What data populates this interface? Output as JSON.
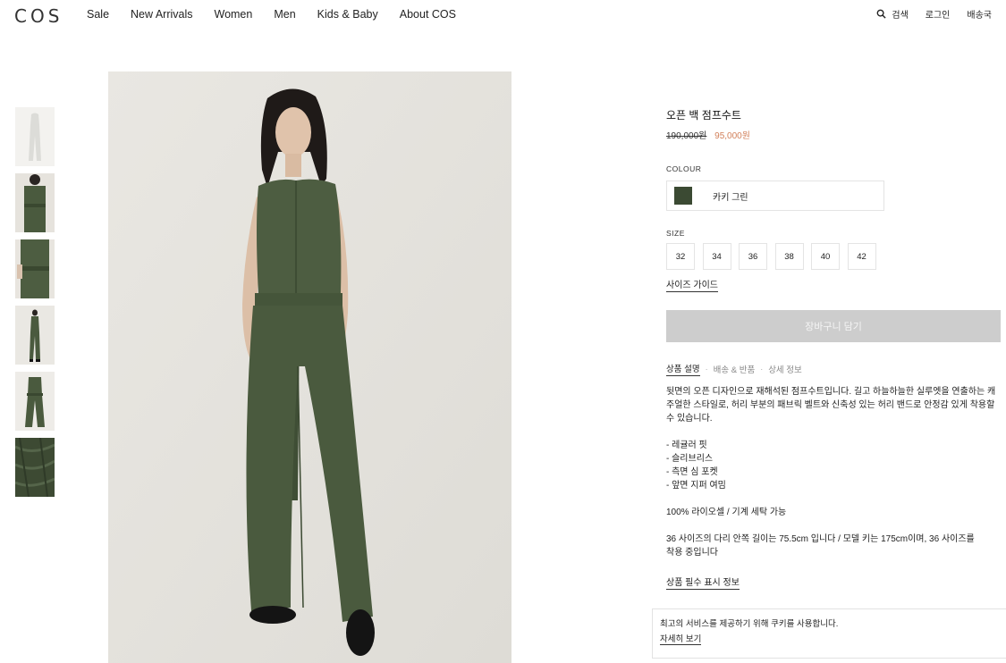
{
  "header": {
    "logo": "COS",
    "nav": [
      "Sale",
      "New Arrivals",
      "Women",
      "Men",
      "Kids & Baby",
      "About COS"
    ],
    "search_label": "검색",
    "login_label": "로그인",
    "shipping_label": "배송국"
  },
  "product": {
    "name": "오픈 백 점프수트",
    "price_original": "190,000원",
    "price_sale": "95,000원",
    "colour_label": "COLOUR",
    "colour_name": "카키 그린",
    "colour_hex": "#3b4a33",
    "size_label": "SIZE",
    "sizes": [
      "32",
      "34",
      "36",
      "38",
      "40",
      "42"
    ],
    "size_guide": "사이즈 가이드",
    "add_to_cart": "장바구니 담기",
    "tabs": [
      "상품 설명",
      "배송 & 반품",
      "상세 정보"
    ],
    "description": "뒷면의 오픈 디자인으로 재해석된 점프수트입니다. 길고 하늘하늘한 실루엣을 연출하는 캐주얼한 스타일로, 허리 부분의 패브릭 벨트와 신축성 있는 허리 밴드로 안정감 있게 착용할 수 있습니다.",
    "features": [
      "- 레귤러 핏",
      "- 슬리브리스",
      "- 측면 심 포켓",
      "- 앞면 지퍼 여밈"
    ],
    "fabric": "100% 라이오셀 / 기계 세탁 가능",
    "model_info": "36 사이즈의 다리 안쪽 길이는 75.5cm 입니다 / 모델 키는 175cm이며, 36 사이즈를 착용 중입니다",
    "info_link": "상품 필수 표시 정보"
  },
  "cookie": {
    "text": "최고의 서비스를 제공하기 위해 쿠키를 사용합니다.",
    "link": "자세히 보기"
  }
}
